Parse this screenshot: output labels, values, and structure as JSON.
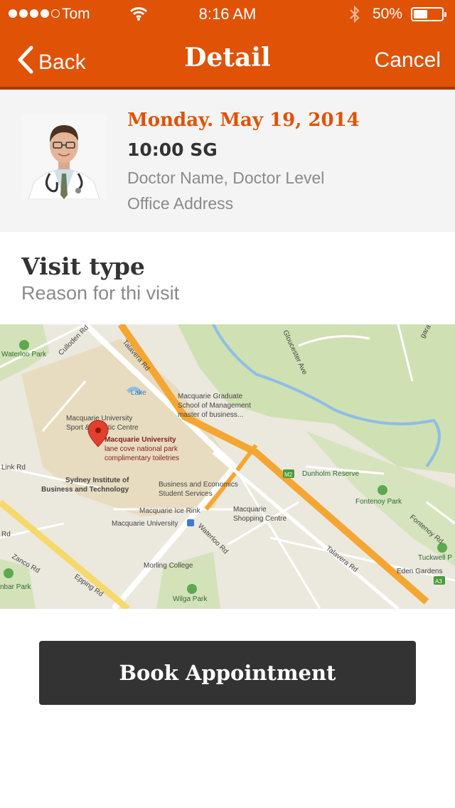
{
  "status_bar": {
    "carrier": "Tom",
    "time": "8:16 AM",
    "battery": "50%",
    "battery_level": 0.5,
    "signal_bars": 4,
    "signal_total": 5
  },
  "nav": {
    "back_label": "Back",
    "title": "Detail",
    "cancel_label": "Cancel"
  },
  "appointment": {
    "date": "Monday. May 19, 2014",
    "time": "10:00 SG",
    "doctor_name": "Doctor Name, Doctor Level",
    "office_address": "Office Address"
  },
  "visit": {
    "title": "Visit type",
    "reason": "Reason for thi visit"
  },
  "map": {
    "labels": {
      "waterloo_park": "Waterloo Park",
      "culloden_rd": "Culloden Rd",
      "talavera_rd": "Talavera Rd",
      "lake": "Lake",
      "gloucester_ave": "Gloucester Ave",
      "grad_school_1": "Macquarie Graduate",
      "grad_school_2": "School of Management",
      "grad_school_3": "master of business...",
      "mq_sport_1": "Macquarie University",
      "mq_sport_2": "Sport & Aquatic Centre",
      "mq_univ": "Macquarie University",
      "mq_univ_sub1": "lane cove national park",
      "mq_univ_sub2": "complimentary toiletries",
      "link_rd": "Link Rd",
      "sydney_inst_1": "Sydney Institute of",
      "sydney_inst_2": "Business and Technology",
      "bus_econ_1": "Business and Economics",
      "bus_econ_2": "Student Services",
      "dunholm": "Dunholm Reserve",
      "fontenoy_park": "Fontenoy Park",
      "fontenoy_rd": "Fontenoy Rd",
      "ice_rink": "Macquarie Ice Rink",
      "mq_shopping_1": "Macquarie",
      "mq_shopping_2": "Shopping Centre",
      "mq_station": "Macquarie University",
      "waterloo_rd": "Waterloo Rd",
      "tuckwell": "Tuckwell P",
      "eden_gardens": "Eden Gardens",
      "zanco": "Zanco Rd",
      "morling": "Morling College",
      "epping_rd": "Epping Rd",
      "wilga_park": "Wilga Park",
      "nbar_park": "nbar Park",
      "rd_left": "Rd",
      "talavera_rd_2": "Talavera Rd",
      "m2": "M2",
      "a3": "A3",
      "gara_st": "gara St"
    }
  },
  "book_button_label": "Book Appointment",
  "colors": {
    "brand": "#e05206",
    "brand_dark": "#a83800",
    "button": "#333333",
    "muted_text": "#8a8a8a"
  },
  "icons": {
    "back": "chevron-left-icon",
    "wifi": "wifi-icon",
    "bluetooth": "bluetooth-icon",
    "battery": "battery-icon",
    "map_pin": "map-pin-icon"
  }
}
